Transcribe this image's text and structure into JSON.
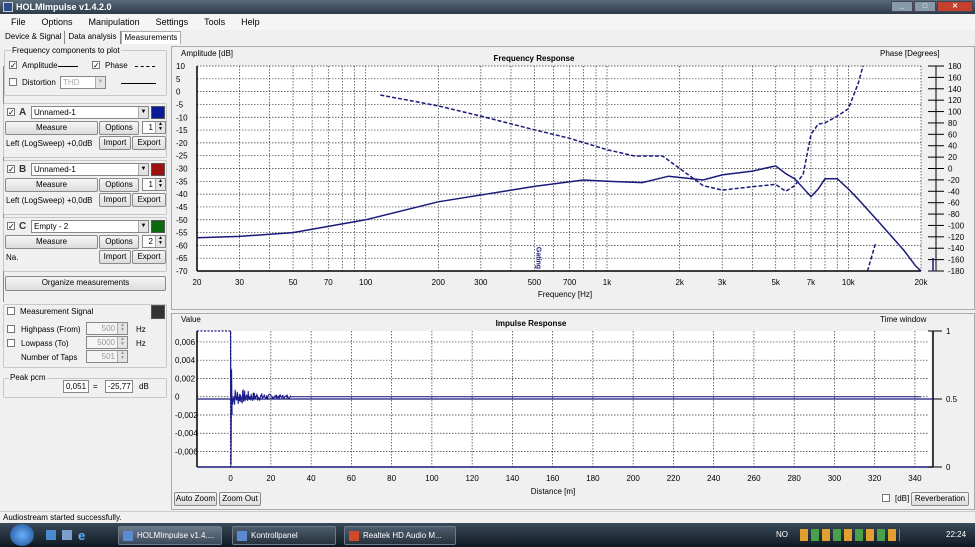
{
  "window": {
    "title": "HOLMImpulse  v1.4.2.0",
    "controls": [
      "_",
      "□",
      "✕"
    ]
  },
  "menu": [
    "File",
    "Options",
    "Manipulation",
    "Settings",
    "Tools",
    "Help"
  ],
  "tabs": [
    {
      "label": "Device & Signal"
    },
    {
      "label": "Data analysis"
    },
    {
      "label": "Measurements",
      "active": true
    }
  ],
  "freq_components": {
    "title": "Frequency components to plot",
    "amplitude": "Amplitude",
    "amplitude_checked": true,
    "phase": "Phase",
    "phase_checked": true,
    "distortion": "Distortion",
    "distortion_checked": false,
    "distortion_select": "THD"
  },
  "measurements": [
    {
      "letter": "A",
      "name": "Unnamed-1",
      "color": "#0a1a9a",
      "measure": "Measure",
      "options": "Options",
      "spin": "1",
      "info": "Left (LogSweep) +0,0dB",
      "import": "Import",
      "export": "Export"
    },
    {
      "letter": "B",
      "name": "Unnamed-1",
      "color": "#a01010",
      "measure": "Measure",
      "options": "Options",
      "spin": "1",
      "info": "Left (LogSweep) +0,0dB",
      "import": "Import",
      "export": "Export"
    },
    {
      "letter": "C",
      "name": "Empty - 2",
      "color": "#0a6a10",
      "measure": "Measure",
      "options": "Options",
      "spin": "2",
      "info": "Na.",
      "import": "Import",
      "export": "Export"
    }
  ],
  "organize": "Organize measurements",
  "signal": {
    "label": "Measurement Signal",
    "color": "#333333",
    "highpass": "Highpass (From)",
    "highpass_val": "500",
    "lowpass": "Lowpass (To)",
    "lowpass_val": "5000",
    "hz": "Hz",
    "taps": "Number of Taps",
    "taps_val": "501"
  },
  "peak": {
    "label": "Peak pcm",
    "value": "0,051",
    "eq": "=",
    "db": "-25,77",
    "unit": "dB"
  },
  "chart_data": [
    {
      "type": "line",
      "title": "Frequency Response",
      "ylabel": "Amplitude [dB]",
      "y2label": "Phase [Degrees]",
      "xlabel": "Frequency [Hz]",
      "xscale": "log",
      "xlim": [
        20,
        20000
      ],
      "ylim": [
        -70,
        10
      ],
      "y2lim": [
        -180,
        180
      ],
      "xticks": [
        20,
        30,
        50,
        70,
        100,
        200,
        300,
        500,
        700,
        1000,
        2000,
        3000,
        5000,
        7000,
        10000,
        20000
      ],
      "xtick_labels": [
        "20",
        "30",
        "50",
        "70",
        "100",
        "200",
        "300",
        "500",
        "700",
        "1k",
        "2k",
        "3k",
        "5k",
        "7k",
        "10k",
        "20k"
      ],
      "yticks": [
        "10",
        "5",
        "0",
        "-5",
        "-10",
        "-15",
        "-20",
        "-25",
        "-30",
        "-35",
        "-40",
        "-45",
        "-50",
        "-55",
        "-60",
        "-65",
        "-70"
      ],
      "y2ticks": [
        "180",
        "160",
        "140",
        "120",
        "100",
        "80",
        "60",
        "40",
        "20",
        "0",
        "-20",
        "-40",
        "-60",
        "-80",
        "-100",
        "-120",
        "-140",
        "-160",
        "-180"
      ],
      "annotation": "Gating",
      "annotation_x": 500,
      "series": [
        {
          "name": "Amplitude",
          "style": "solid",
          "color": "#1a1a7a",
          "x": [
            20,
            30,
            50,
            100,
            200,
            500,
            800,
            1000,
            1400,
            1800,
            2500,
            3000,
            4000,
            5000,
            5500,
            6000,
            7000,
            7500,
            8000,
            9000,
            10000,
            11000,
            14000,
            17000,
            19000,
            20000
          ],
          "y": [
            -57,
            -56.5,
            -55,
            -50,
            -43,
            -37,
            -34.5,
            -35,
            -35.5,
            -33,
            -34.5,
            -32.5,
            -31,
            -29,
            -32,
            -34,
            -41,
            -38,
            -34,
            -34,
            -38,
            -42,
            -53,
            -62,
            -68,
            -70
          ]
        },
        {
          "name": "Phase",
          "style": "dashed",
          "color": "#1a1a7a",
          "axis": "right",
          "x": [
            115,
            200,
            300,
            500,
            700,
            1000,
            1300,
            1700,
            2000,
            2500,
            3000,
            4000,
            5000,
            5500,
            6000,
            6500,
            7000,
            7500,
            8000,
            9000,
            10000,
            11000,
            11500
          ],
          "y": [
            129,
            110,
            92,
            68,
            53,
            33,
            22,
            22,
            0,
            -30,
            -38,
            -32,
            -28,
            -40,
            -30,
            -10,
            60,
            78,
            80,
            92,
            105,
            150,
            180
          ]
        },
        {
          "name": "Phase (wrapped)",
          "style": "dashed",
          "color": "#1a1a7a",
          "axis": "right",
          "x": [
            12000,
            13000
          ],
          "y": [
            -180,
            -130
          ]
        }
      ]
    },
    {
      "type": "line",
      "title": "Impulse Response",
      "ylabel": "Value",
      "y2label": "Time window",
      "xlabel": "Distance [m]",
      "xlim": [
        -16.7,
        345
      ],
      "ylim": [
        -0.0077,
        0.0072
      ],
      "y2lim": [
        0,
        1
      ],
      "xticks": [
        0,
        20,
        40,
        60,
        80,
        100,
        120,
        140,
        160,
        180,
        200,
        220,
        240,
        260,
        280,
        300,
        320,
        340
      ],
      "yticks": [
        0.006,
        0.004,
        0.002,
        0,
        -0.002,
        -0.004,
        -0.006
      ],
      "ytick_labels": [
        "0,006",
        "0,004",
        "0,002",
        "0",
        "-0,002",
        "-0,004",
        "-0,006"
      ],
      "y2ticks": [
        "1",
        "0.5",
        "0"
      ],
      "series": [
        {
          "name": "Impulse",
          "peak_at": 0,
          "peak_max": 0.0072,
          "peak_min": -0.0075,
          "decay_until": 30
        },
        {
          "name": "Time window",
          "level": 0.5
        }
      ]
    }
  ],
  "impulse_buttons": {
    "auto_zoom": "Auto Zoom",
    "zoom_out": "Zoom Out",
    "db": "[dB]",
    "reverberation": "Reverberation"
  },
  "status": "Audiostream started successfully.",
  "taskbar": {
    "items": [
      "HOLMImpulse v1.4....",
      "Kontrollpanel",
      "Realtek HD Audio M..."
    ],
    "lang": "NO",
    "clock": "22:24"
  }
}
